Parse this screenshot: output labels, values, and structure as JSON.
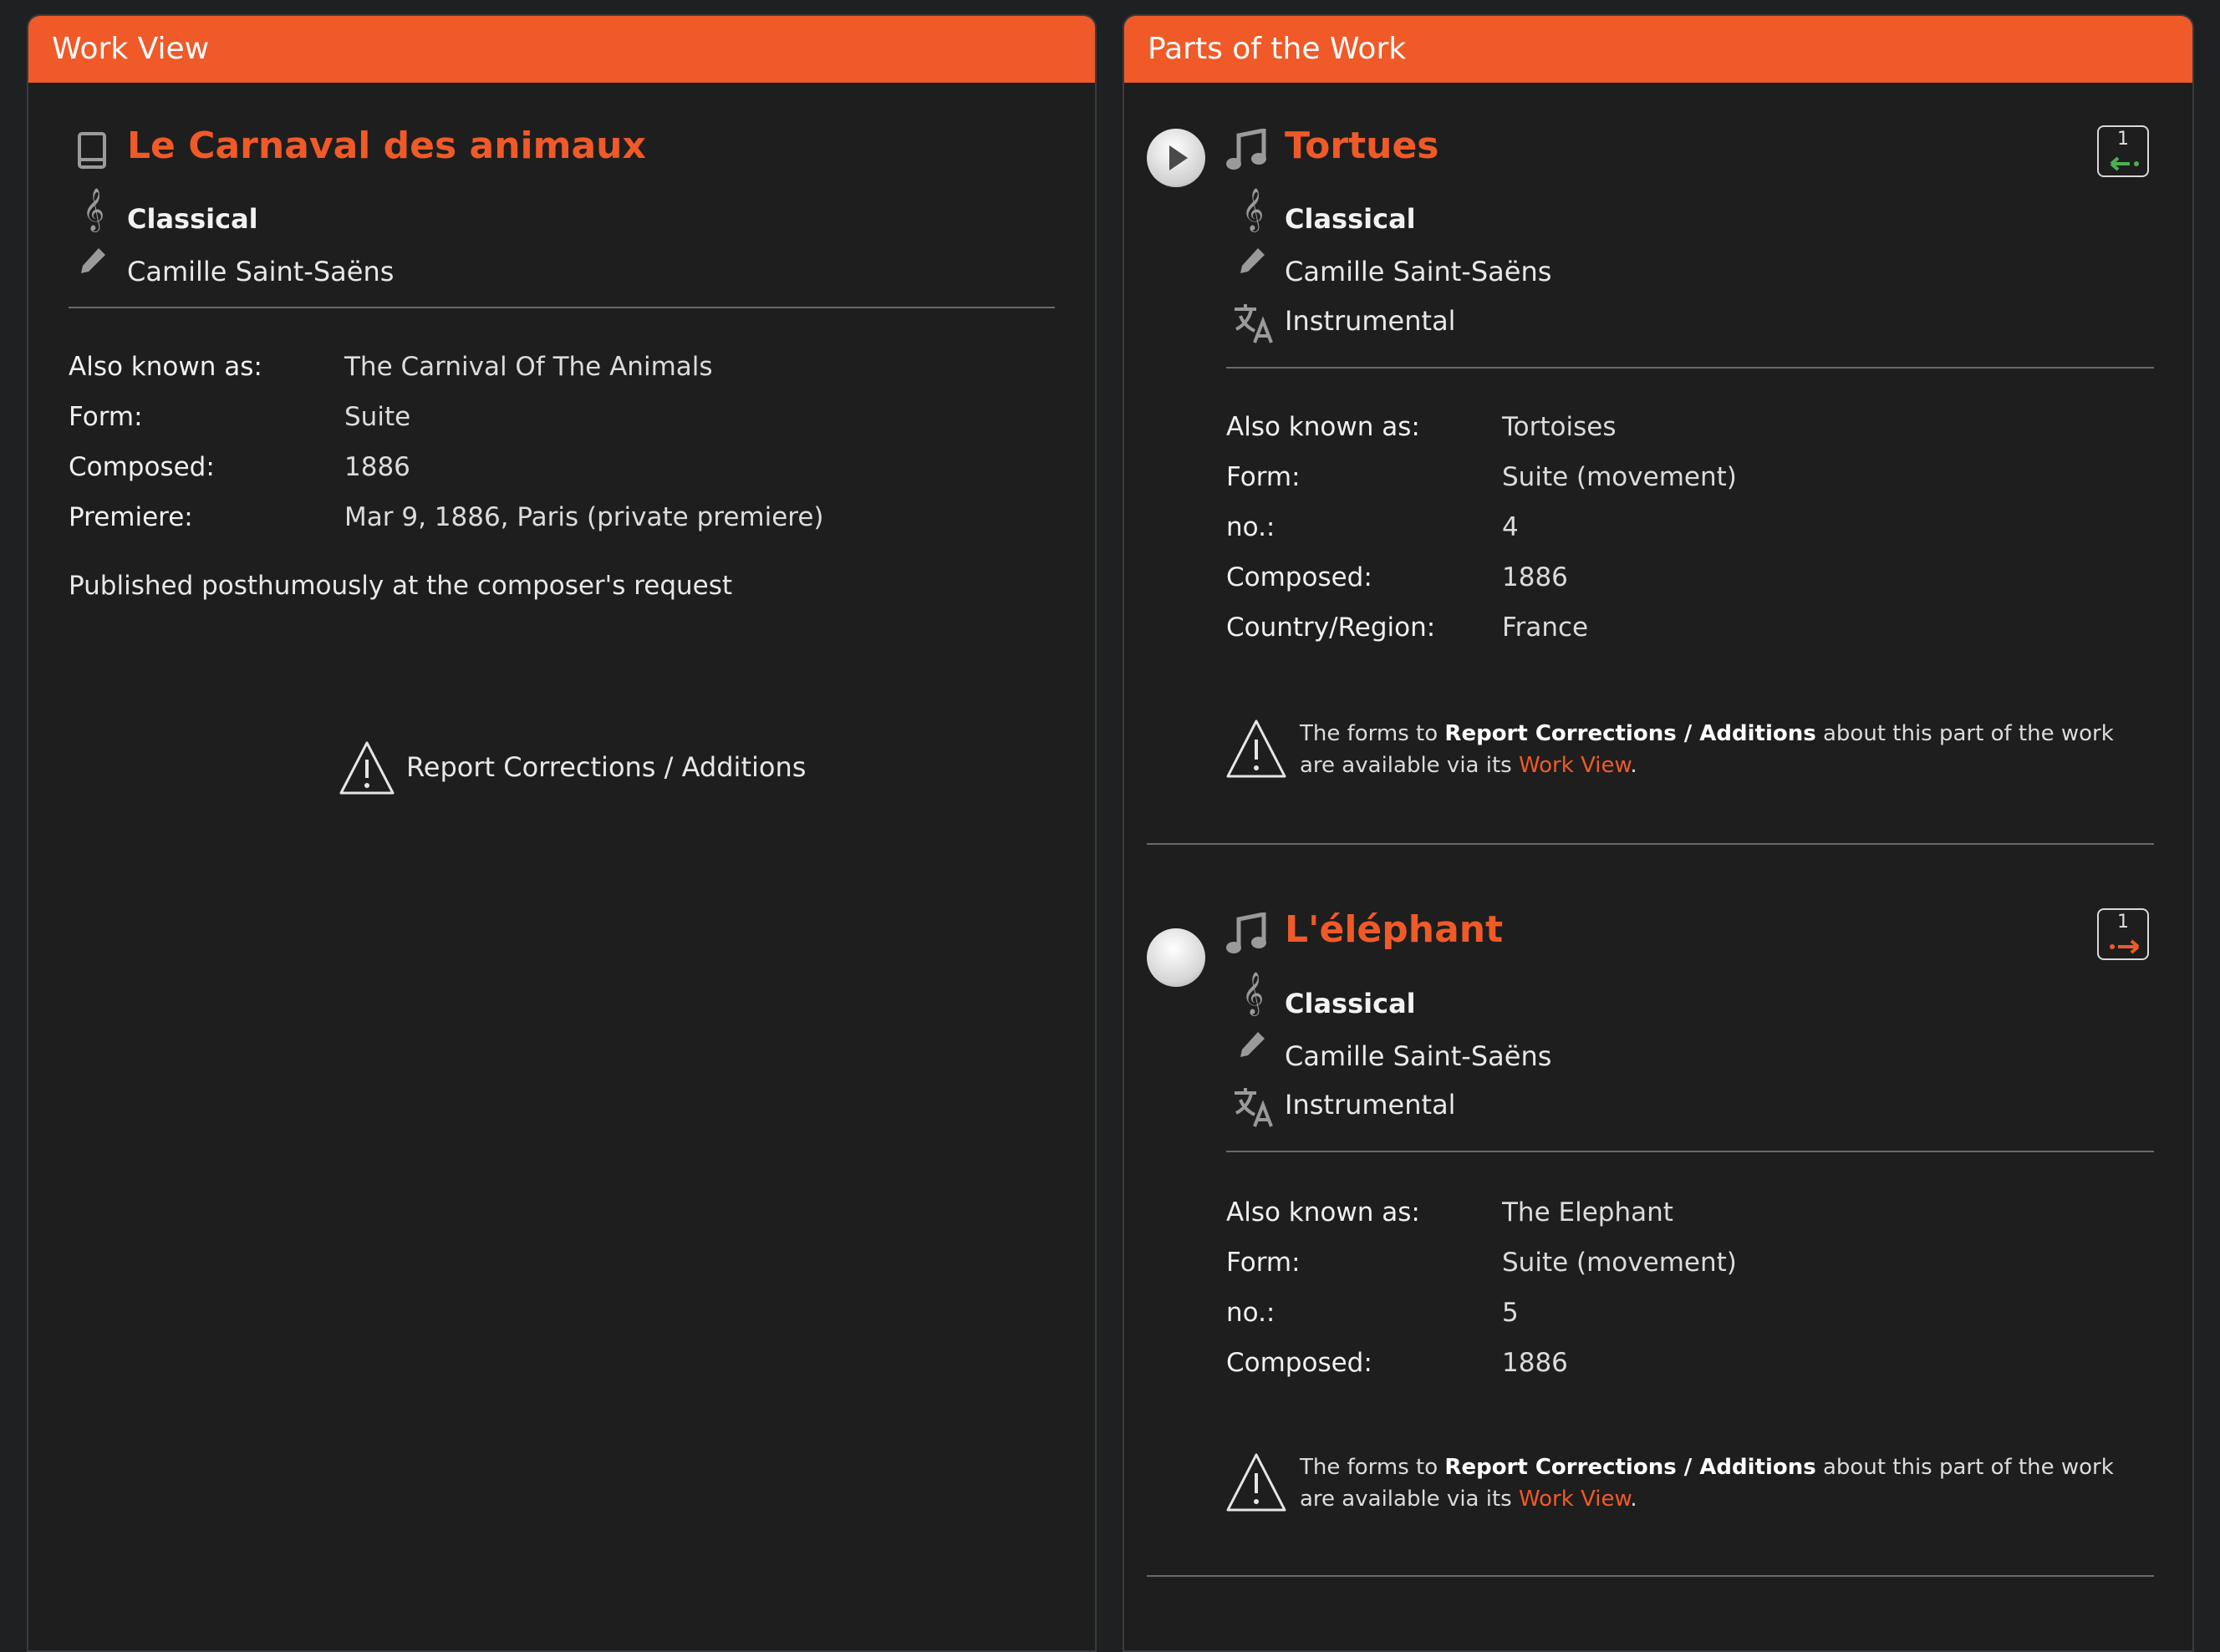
{
  "work_view": {
    "header": "Work View",
    "title": "Le Carnaval des animaux",
    "genre": "Classical",
    "composer": "Camille Saint-Saëns",
    "fields": [
      {
        "label": "Also known as:",
        "value": "The Carnival Of The Animals"
      },
      {
        "label": "Form:",
        "value": "Suite"
      },
      {
        "label": "Composed:",
        "value": "1886"
      },
      {
        "label": "Premiere:",
        "value": "Mar 9, 1886, Paris (private premiere)"
      }
    ],
    "note": "Published posthumously at the composer's request",
    "report_link": "Report Corrections / Additions"
  },
  "parts": {
    "header": "Parts of the Work",
    "items": [
      {
        "title": "Tortues",
        "genre": "Classical",
        "composer": "Camille Saint-Saëns",
        "language": "Instrumental",
        "badge_count": "1",
        "badge_arrow": "back",
        "badge_arrow_color": "#4caf50",
        "fields": [
          {
            "label": "Also known as:",
            "value": "Tortoises"
          },
          {
            "label": "Form:",
            "value": "Suite (movement)"
          },
          {
            "label": "no.:",
            "value": "4"
          },
          {
            "label": "Composed:",
            "value": "1886"
          },
          {
            "label": "Country/Region:",
            "value": "France"
          }
        ],
        "notice": {
          "prefix": "The forms to ",
          "bold": "Report Corrections / Additions",
          "middle": " about this part of the work are available via its ",
          "link": "Work View",
          "suffix": "."
        }
      },
      {
        "title": "L'éléphant",
        "genre": "Classical",
        "composer": "Camille Saint-Saëns",
        "language": "Instrumental",
        "badge_count": "1",
        "badge_arrow": "forward",
        "badge_arrow_color": "#f05a28",
        "fields": [
          {
            "label": "Also known as:",
            "value": "The Elephant"
          },
          {
            "label": "Form:",
            "value": "Suite (movement)"
          },
          {
            "label": "no.:",
            "value": "5"
          },
          {
            "label": "Composed:",
            "value": "1886"
          }
        ],
        "notice": {
          "prefix": "The forms to ",
          "bold": "Report Corrections / Additions",
          "middle": " about this part of the work are available via its ",
          "link": "Work View",
          "suffix": "."
        }
      }
    ]
  },
  "colors": {
    "accent": "#f05a28",
    "background": "#1e1e1e"
  }
}
